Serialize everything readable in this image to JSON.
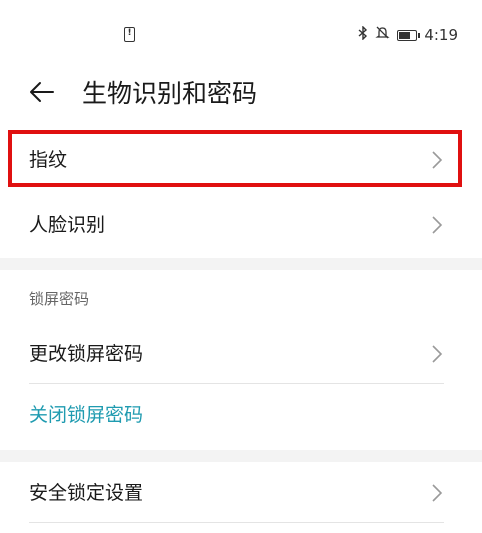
{
  "status_bar": {
    "left_icon": "alert-icon",
    "left_icon_glyph": "!",
    "icons": [
      "bluetooth-icon",
      "mute-icon",
      "battery-icon"
    ],
    "time": "4:19"
  },
  "header": {
    "back_icon": "arrow-left-icon",
    "title": "生物识别和密码"
  },
  "biometric_items": [
    {
      "label": "指纹",
      "highlighted": true
    },
    {
      "label": "人脸识别"
    }
  ],
  "lock_section": {
    "title": "锁屏密码",
    "change_label": "更改锁屏密码",
    "disable_label": "关闭锁屏密码"
  },
  "security_lock": {
    "label": "安全锁定设置"
  },
  "colors": {
    "highlight": "#e01010",
    "link": "#1f9bb0",
    "section_gap": "#f3f3f3"
  }
}
